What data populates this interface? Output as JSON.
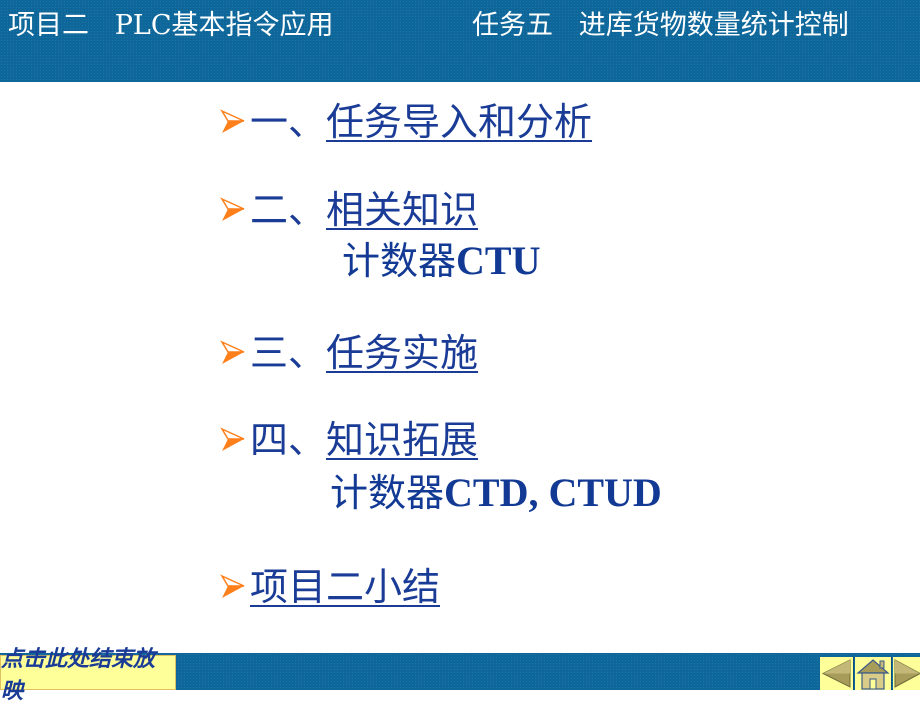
{
  "header": {
    "project_title": "项目二   PLC基本指令应用",
    "task_title": "任务五   进库货物数量统计控制"
  },
  "menu": {
    "items": [
      {
        "number": "一、",
        "label": "任务导入和分析",
        "sub": null
      },
      {
        "number": "二、",
        "label": "相关知识",
        "sub_cn": "计数器",
        "sub_en": "CTU"
      },
      {
        "number": "三、",
        "label": "任务实施",
        "sub": null
      },
      {
        "number": "四、",
        "label": "知识拓展",
        "sub_cn": "计数器",
        "sub_en": "CTD, CTUD"
      },
      {
        "number": "",
        "label": "项目二小结",
        "sub": null
      }
    ]
  },
  "footer": {
    "end_show_label": "点击此处结束放映",
    "nav": {
      "prev": "previous-slide",
      "home": "home",
      "next": "next-slide"
    }
  },
  "colors": {
    "header_bg": "#0e6699",
    "text_blue": "#1a3c96",
    "bullet_orange": "#ff7f1a",
    "button_yellow": "#ffff99",
    "nav_icon": "#a89c5a"
  }
}
